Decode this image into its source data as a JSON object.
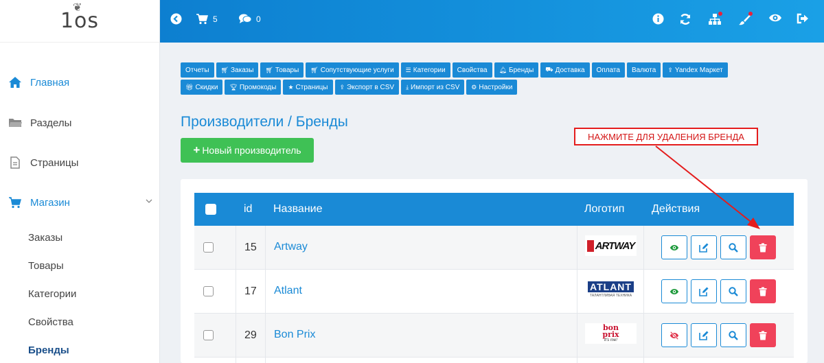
{
  "logo": {
    "text": "1os"
  },
  "sidebar": {
    "items": [
      {
        "label": "Главная",
        "icon": "home-icon"
      },
      {
        "label": "Разделы",
        "icon": "folder-icon"
      },
      {
        "label": "Страницы",
        "icon": "file-icon"
      },
      {
        "label": "Магазин",
        "icon": "cart-icon"
      }
    ],
    "sub_items": [
      "Заказы",
      "Товары",
      "Категории",
      "Свойства",
      "Бренды"
    ]
  },
  "topbar": {
    "cart_count": "5",
    "comments_count": "0"
  },
  "tabs": {
    "row1": [
      "Отчеты",
      "Заказы",
      "Товары",
      "Сопутствующие услуги",
      "Категории",
      "Свойства",
      "Бренды",
      "Доставка",
      "Оплата",
      "Валюта",
      "Yandex Маркет"
    ],
    "row2": [
      "Скидки",
      "Промокоды",
      "Страницы",
      "Экспорт в CSV",
      "Импорт из CSV",
      "Настройки"
    ]
  },
  "page": {
    "title": "Производители / Бренды",
    "new_button": "Новый производитель",
    "callout": "НАЖМИТЕ ДЛЯ УДАЛЕНИЯ БРЕНДА"
  },
  "table": {
    "headers": {
      "id": "id",
      "name": "Название",
      "logo": "Логотип",
      "actions": "Действия"
    },
    "rows": [
      {
        "id": "15",
        "name": "Artway",
        "logo_text": "ARTWAY",
        "visible": true
      },
      {
        "id": "17",
        "name": "Atlant",
        "logo_text": "ATLANT",
        "logo_sub": "ТАЛАНТЛИВАЯ ТЕХНИКА",
        "visible": true
      },
      {
        "id": "29",
        "name": "Bon Prix",
        "logo_text": "bon prix",
        "logo_sub": "it's me!",
        "visible": false
      }
    ]
  },
  "colors": {
    "accent": "#1a8ad6",
    "success": "#3fc155",
    "danger": "#f0425a",
    "callout": "#e41c1c"
  }
}
